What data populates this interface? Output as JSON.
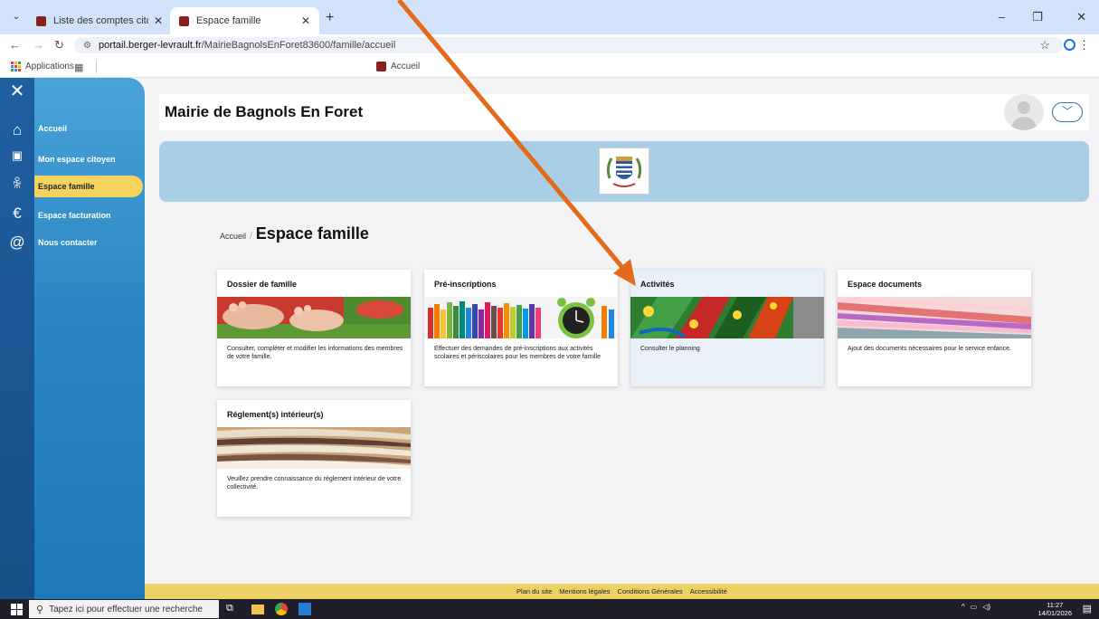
{
  "browser": {
    "tabs": [
      {
        "label": "Liste des comptes citoyens",
        "active": false
      },
      {
        "label": "Espace famille",
        "active": true
      }
    ],
    "url_host": "portail.berger-levrault.fr",
    "url_path": "/MairieBagnolsEnForet83600/famille/accueil",
    "bookmarks": {
      "apps_label": "Applications",
      "accueil_label": "Accueil"
    }
  },
  "sidebar": {
    "items": [
      {
        "label": "Accueil",
        "icon": "home-icon"
      },
      {
        "label": "Mon espace citoyen",
        "icon": "id-card-icon"
      },
      {
        "label": "Espace famille",
        "icon": "family-icon",
        "active": true
      },
      {
        "label": "Espace facturation",
        "icon": "euro-icon"
      },
      {
        "label": "Nous contacter",
        "icon": "at-icon"
      }
    ]
  },
  "header": {
    "title": "Mairie de Bagnols En Foret"
  },
  "breadcrumb": {
    "home": "Accueil",
    "separator": "/",
    "current": "Espace famille"
  },
  "cards": [
    {
      "title": "Dossier de famille",
      "description": "Consulter, compléter et modifier les informations des membres de votre famille."
    },
    {
      "title": "Pré-inscriptions",
      "description": "Effectuer des demandes de pré-inscriptions aux activités scolaires et périscolaires pour les membres de votre famille"
    },
    {
      "title": "Activités",
      "description": "Consulter le planning"
    },
    {
      "title": "Espace documents",
      "description": "Ajout des documents nécessaires pour le service enfance."
    },
    {
      "title": "Réglement(s) intérieur(s)",
      "description": "Veuillez prendre connaissance du réglement intérieur de votre collectivité."
    }
  ],
  "footer": {
    "links": [
      "Plan du site",
      "Mentions légales",
      "Conditions Générales",
      "Accessibilité"
    ]
  },
  "taskbar": {
    "search_placeholder": "Tapez ici pour effectuer une recherche",
    "time": "11:27",
    "date": "14/01/2026"
  },
  "colors": {
    "accent_yellow": "#f4d35e",
    "sidebar_blue": "#2a86c3",
    "banner_blue": "#a9cfe6",
    "arrow_orange": "#e26a1a"
  }
}
